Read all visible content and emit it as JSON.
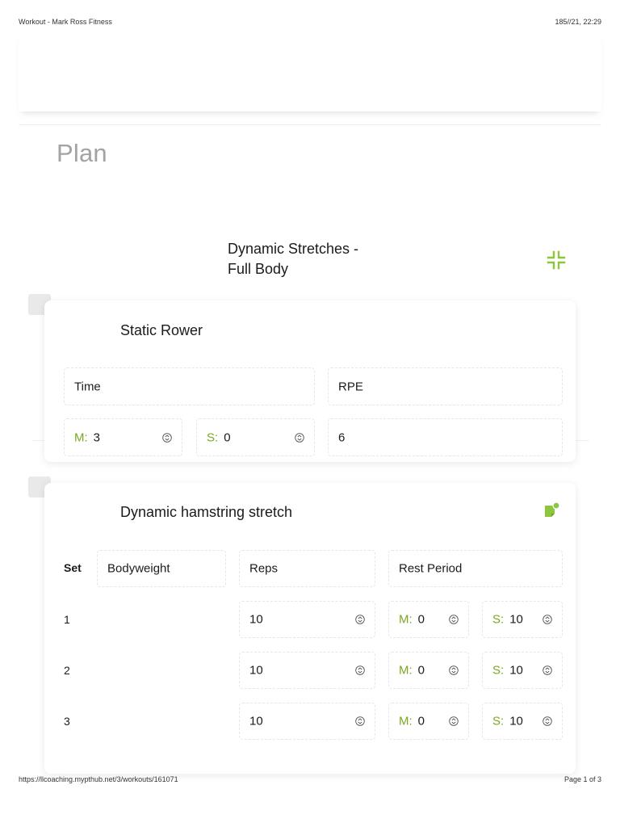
{
  "print": {
    "tab_title": "Workout - Mark Ross Fitness",
    "datetime": "185//21, 22:29",
    "url": "https://llcoaching.mypthub.net/3/workouts/161071",
    "page": "Page 1 of 3"
  },
  "plan": {
    "title": "Plan",
    "circuit": {
      "title_line1": "Dynamic Stretches -",
      "title_line2": "Full Body",
      "collapse_icon": "collapse-icon"
    }
  },
  "exercises": [
    {
      "name": "Static Rower",
      "col_time": "Time",
      "col_rpe": "RPE",
      "time_m_label": "M:",
      "time_m": "3",
      "time_s_label": "S:",
      "time_s": "0",
      "rpe": "6"
    },
    {
      "name": "Dynamic hamstring stretch",
      "note_icon": "note-icon",
      "headers": {
        "set": "Set",
        "load": "Bodyweight",
        "reps": "Reps",
        "rest": "Rest Period"
      },
      "sets": [
        {
          "num": "1",
          "reps": "10",
          "m_label": "M:",
          "m": "0",
          "s_label": "S:",
          "s": "10"
        },
        {
          "num": "2",
          "reps": "10",
          "m_label": "M:",
          "m": "0",
          "s_label": "S:",
          "s": "10"
        },
        {
          "num": "3",
          "reps": "10",
          "m_label": "M:",
          "m": "0",
          "s_label": "S:",
          "s": "10"
        }
      ]
    }
  ],
  "colors": {
    "accent": "#7aa81e",
    "icon_accent": "#8cc63f",
    "plan_title": "#a3a3a3"
  }
}
